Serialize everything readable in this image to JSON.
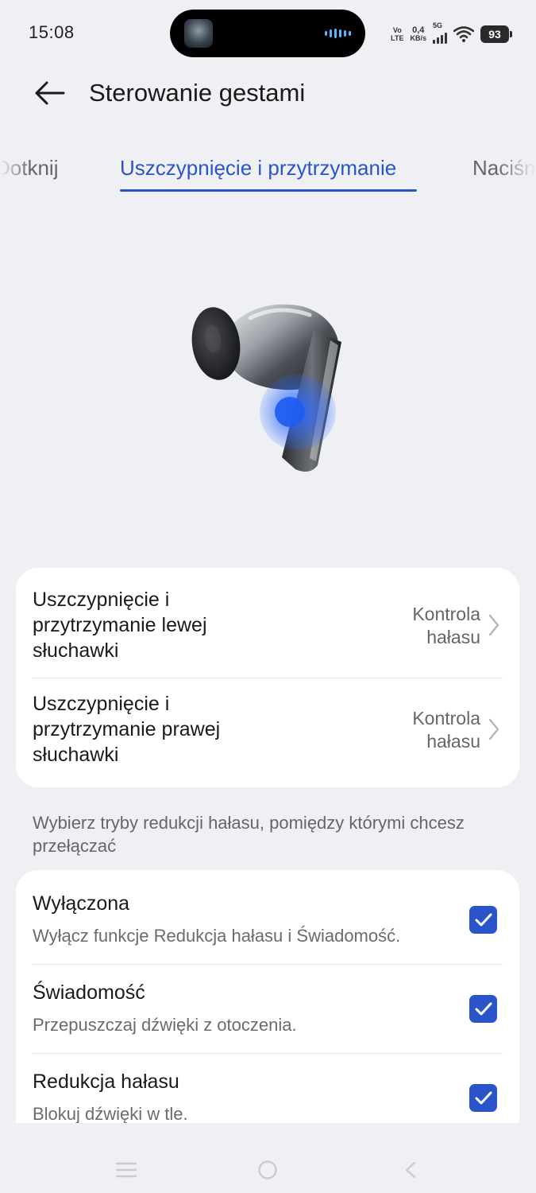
{
  "status_bar": {
    "time": "15:08",
    "volte_top": "Vo",
    "volte_bottom": "LTE",
    "speed_value": "0,4",
    "speed_unit": "KB/s",
    "network": "5G",
    "battery": "93"
  },
  "header": {
    "title": "Sterowanie gestami",
    "back_icon": "arrow-left-icon"
  },
  "tabs": [
    {
      "label": "Dotknij",
      "active": false
    },
    {
      "label": "Uszczypnięcie i przytrzymanie",
      "active": true
    },
    {
      "label": "Naciśnij",
      "active": false
    }
  ],
  "gestures": [
    {
      "label": "Uszczypnięcie i przytrzymanie lewej słuchawki",
      "value": "Kontrola hałasu"
    },
    {
      "label": "Uszczypnięcie i przytrzymanie prawej słuchawki",
      "value": "Kontrola hałasu"
    }
  ],
  "hint": "Wybierz tryby redukcji hałasu, pomiędzy którymi chcesz przełączać",
  "modes": [
    {
      "title": "Wyłączona",
      "description": "Wyłącz funkcje Redukcja hałasu i Świadomość.",
      "checked": true
    },
    {
      "title": "Świadomość",
      "description": "Przepuszczaj dźwięki z otoczenia.",
      "checked": true
    },
    {
      "title": "Redukcja hałasu",
      "description": "Blokuj dźwięki w tle.",
      "checked": true
    }
  ],
  "colors": {
    "accent": "#2a55c9",
    "background": "#eef0f4",
    "card": "#ffffff"
  },
  "navbar": {
    "icons": [
      "menu-icon",
      "home-circle-icon",
      "back-triangle-icon"
    ]
  }
}
